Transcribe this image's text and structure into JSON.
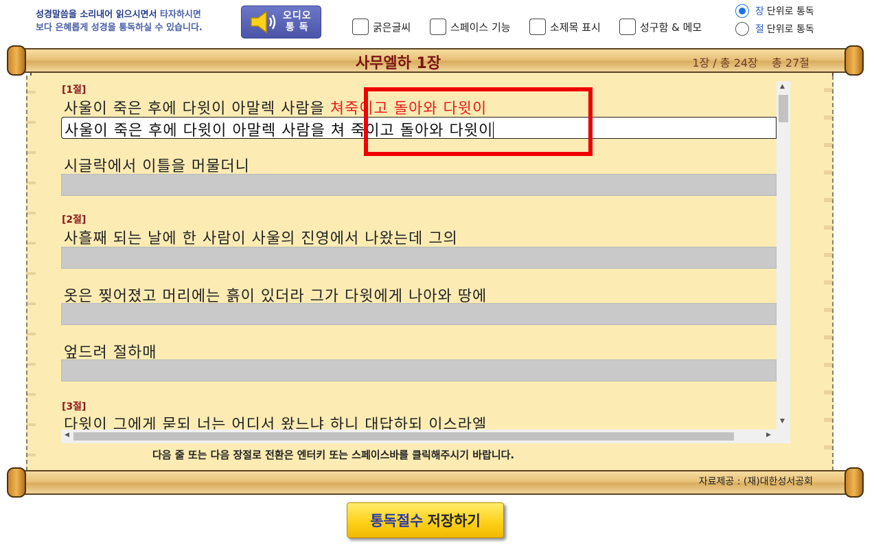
{
  "header": {
    "notice_line1_em": "성경말씀을 소리내어 읽으시면서",
    "notice_line1_rest": " 타자하시면",
    "notice_line2": "보다 은혜롭게 성경을 통독하실 수 있습니다.",
    "audio_label_top": "오디오",
    "audio_label_bottom": "통 독"
  },
  "options": [
    {
      "label": "굵은글씨",
      "checked": false
    },
    {
      "label": "스페이스 기능",
      "checked": false
    },
    {
      "label": "소제목 표시",
      "checked": false
    },
    {
      "label": "성구함 & 메모",
      "checked": false
    }
  ],
  "read_mode": {
    "chapter_unit": "장",
    "chapter_rest": "단위로 통독",
    "verse_unit": "절",
    "verse_rest": "단위로 통독",
    "selected": "chapter"
  },
  "chapter": {
    "title": "사무엘하 1장",
    "info": "1장 / 총 24장    총 27절"
  },
  "verses": [
    {
      "label": "[1절]",
      "line1_plain": "사울이 죽은 후에 다윗이 아말렉 사람을 ",
      "line1_typed": "쳐죽이고 돌아와 다윗이",
      "input1": "사울이 죽은 후에 다윗이 아말렉 사람을 쳐 죽이고 돌아와 다윗이",
      "line2": "시글락에서 이틀을 머물더니"
    },
    {
      "label": "[2절]",
      "line1": "사흘째 되는 날에 한 사람이 사울의 진영에서 나왔는데 그의",
      "line2": "옷은 찢어졌고 머리에는 흙이 있더라 그가 다윗에게 나아와 땅에",
      "line3": "엎드려 절하매"
    },
    {
      "label": "[3절]",
      "line1": "다윗이 그에게 묻되 너는 어디서 왔느냐 하니 대답하되 이스라엘"
    }
  ],
  "footer": {
    "hint": "다음 줄 또는 다음 장절로 전환은 엔터키 또는 스페이스바를 클릭해주시기 바랍니다.",
    "credit": "자료제공 : (재)대한성서공회",
    "save_a": "통독절수",
    "save_b": "저장하기"
  }
}
